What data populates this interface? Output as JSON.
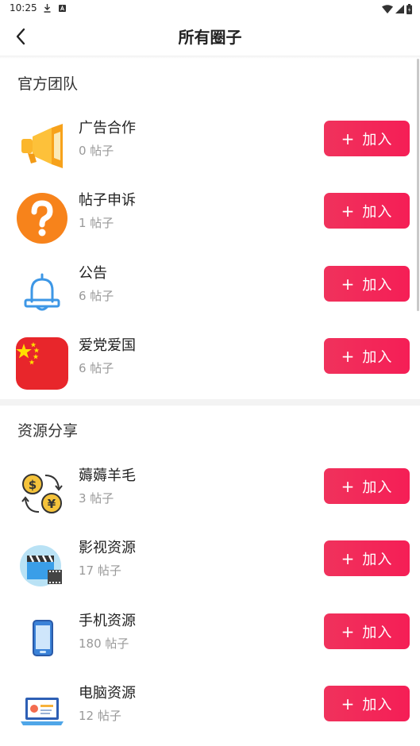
{
  "status_bar": {
    "time": "10:25"
  },
  "header": {
    "title": "所有圈子"
  },
  "sections": [
    {
      "title": "官方团队",
      "items": [
        {
          "name": "广告合作",
          "count": "0 帖子",
          "icon": "megaphone-icon"
        },
        {
          "name": "帖子申诉",
          "count": "1 帖子",
          "icon": "question-mark-icon"
        },
        {
          "name": "公告",
          "count": "6 帖子",
          "icon": "bell-icon"
        },
        {
          "name": "爱党爱国",
          "count": "6 帖子",
          "icon": "china-flag-icon"
        }
      ]
    },
    {
      "title": "资源分享",
      "items": [
        {
          "name": "薅薅羊毛",
          "count": "3 帖子",
          "icon": "currency-exchange-icon"
        },
        {
          "name": "影视资源",
          "count": "17 帖子",
          "icon": "film-clapper-icon"
        },
        {
          "name": "手机资源",
          "count": "180 帖子",
          "icon": "smartphone-icon"
        },
        {
          "name": "电脑资源",
          "count": "12 帖子",
          "icon": "laptop-icon"
        }
      ]
    }
  ],
  "join_button": {
    "plus": "+",
    "label": "加入"
  },
  "colors": {
    "accent": "#f0325c",
    "title": "#222222",
    "subtitle": "#999999"
  }
}
